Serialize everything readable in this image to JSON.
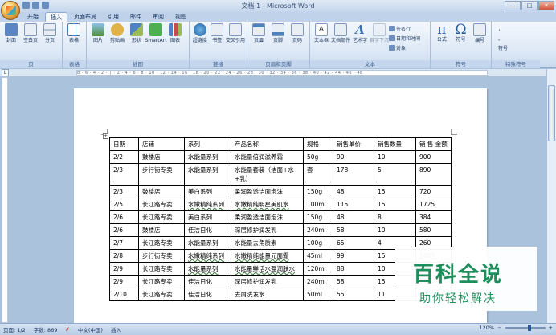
{
  "window": {
    "title": "文档 1 - Microsoft Word",
    "controls": [
      "—",
      "□",
      "✕"
    ]
  },
  "tabs": [
    "开始",
    "插入",
    "页面布局",
    "引用",
    "邮件",
    "审阅",
    "视图"
  ],
  "active_tab": "插入",
  "ribbon": {
    "groups": [
      {
        "name": "页",
        "buttons": [
          "封面",
          "空白页",
          "分页"
        ]
      },
      {
        "name": "表格",
        "buttons": [
          "表格"
        ]
      },
      {
        "name": "插图",
        "buttons": [
          "图片",
          "剪贴画",
          "形状",
          "SmartArt",
          "图表"
        ]
      },
      {
        "name": "链接",
        "buttons": [
          "超链接",
          "书签",
          "交叉引用"
        ]
      },
      {
        "name": "页眉和页脚",
        "buttons": [
          "页眉",
          "页脚",
          "页码"
        ]
      },
      {
        "name": "文本",
        "buttons": [
          "文本框",
          "文档部件",
          "艺术字",
          "首字下沉"
        ],
        "small": [
          "签名行",
          "日期和时间",
          "对象"
        ]
      },
      {
        "name": "符号",
        "buttons": [
          "公式",
          "符号",
          "编号"
        ]
      },
      {
        "name": "特殊符号",
        "small": [
          "，",
          "。",
          "符号"
        ]
      }
    ]
  },
  "ruler": {
    "corner": "L",
    "scale": "8 · 6 · 4 · 2 · │ · 2 · 4 · 6 · 8 · 10 · 12 · 14 · 16 · 18 · 20 · 22 · 24 · 26 · 28 · 30 · 32 · 34 · 36 · 38 · 40 · 42 · 44 · 46 · 48"
  },
  "table": {
    "headers": [
      "日期",
      "店铺",
      "系列",
      "产品名称",
      "规格",
      "销售单价",
      "销售数量",
      "销 售 金额"
    ],
    "rows": [
      [
        "2/2",
        "鼓楼店",
        "水能量系列",
        "水能量倍润滋养霜",
        "50g",
        "90",
        "10",
        "900"
      ],
      [
        "2/3",
        "步行街专卖",
        "水能量系列",
        "水能量套装（洁面+水+乳）",
        "套",
        "178",
        "5",
        "890"
      ],
      [
        "2/3",
        "鼓楼店",
        "美白系列",
        "柔润盈透洁面泡沫",
        "150g",
        "48",
        "15",
        "720"
      ],
      [
        "2/5",
        "长江路专卖",
        "水嫩精纯系列",
        "水嫩精纯明星美肌水",
        "100ml",
        "115",
        "15",
        "1725"
      ],
      [
        "2/6",
        "长江路专卖",
        "美白系列",
        "柔润盈透洁面泡沫",
        "150g",
        "48",
        "8",
        "384"
      ],
      [
        "2/6",
        "鼓楼店",
        "佳洁日化",
        "深层修护润发乳",
        "240ml",
        "58",
        "10",
        "580"
      ],
      [
        "2/7",
        "长江路专卖",
        "水能量系列",
        "水能量去角质素",
        "100g",
        "65",
        "4",
        "260"
      ],
      [
        "2/8",
        "步行街专卖",
        "水嫩精纯系列",
        "水嫩精纯能量元面霜",
        "45ml",
        "99",
        "15",
        "1485"
      ],
      [
        "2/9",
        "长江路专卖",
        "水能量系列",
        "水能量鲜活水盈润肤水",
        "120ml",
        "88",
        "10",
        "880"
      ],
      [
        "2/9",
        "长江路专卖",
        "佳洁日化",
        "深层修护润发乳",
        "240ml",
        "58",
        "15",
        "870"
      ],
      [
        "2/10",
        "长江路专卖",
        "佳洁日化",
        "去屑洗发水",
        "50ml",
        "55",
        "11",
        "605"
      ]
    ]
  },
  "status": {
    "page": "页面: 1/2",
    "words": "字数: 869",
    "lang": "中文(中国)",
    "mode": "插入",
    "zoom": "120%"
  },
  "watermark": {
    "big": "百科全说",
    "small": "助你轻松解决"
  }
}
